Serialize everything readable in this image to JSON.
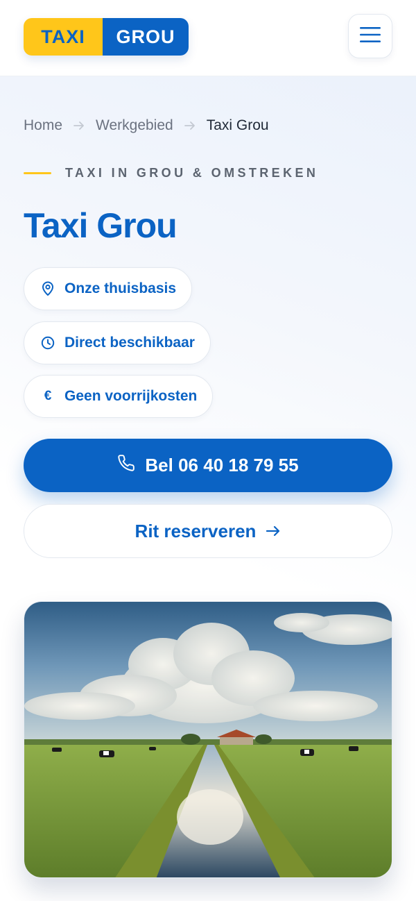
{
  "header": {
    "logo_left": "TAXI",
    "logo_right": "GROU",
    "menu_icon": "hamburger-menu-icon"
  },
  "breadcrumb": {
    "items": [
      "Home",
      "Werkgebied",
      "Taxi Grou"
    ],
    "separator_icon": "arrow-right-icon"
  },
  "hero": {
    "eyebrow": "TAXI IN GROU & OMSTREKEN",
    "title": "Taxi Grou",
    "pills": [
      {
        "icon": "map-pin-icon",
        "label": "Onze thuisbasis"
      },
      {
        "icon": "clock-icon",
        "label": "Direct beschikbaar"
      },
      {
        "icon": "euro-icon",
        "label": "Geen voorrijkosten",
        "glyph": "€"
      }
    ],
    "call_button": {
      "icon": "phone-icon",
      "label": "Bel 06 40 18 79 55"
    },
    "reserve_button": {
      "label": "Rit reserveren",
      "icon": "arrow-right-icon"
    },
    "image_icon": "landscape-photo"
  },
  "colors": {
    "brand_blue": "#0b63c4",
    "brand_yellow": "#ffc61a",
    "text_muted": "#6b7280"
  }
}
